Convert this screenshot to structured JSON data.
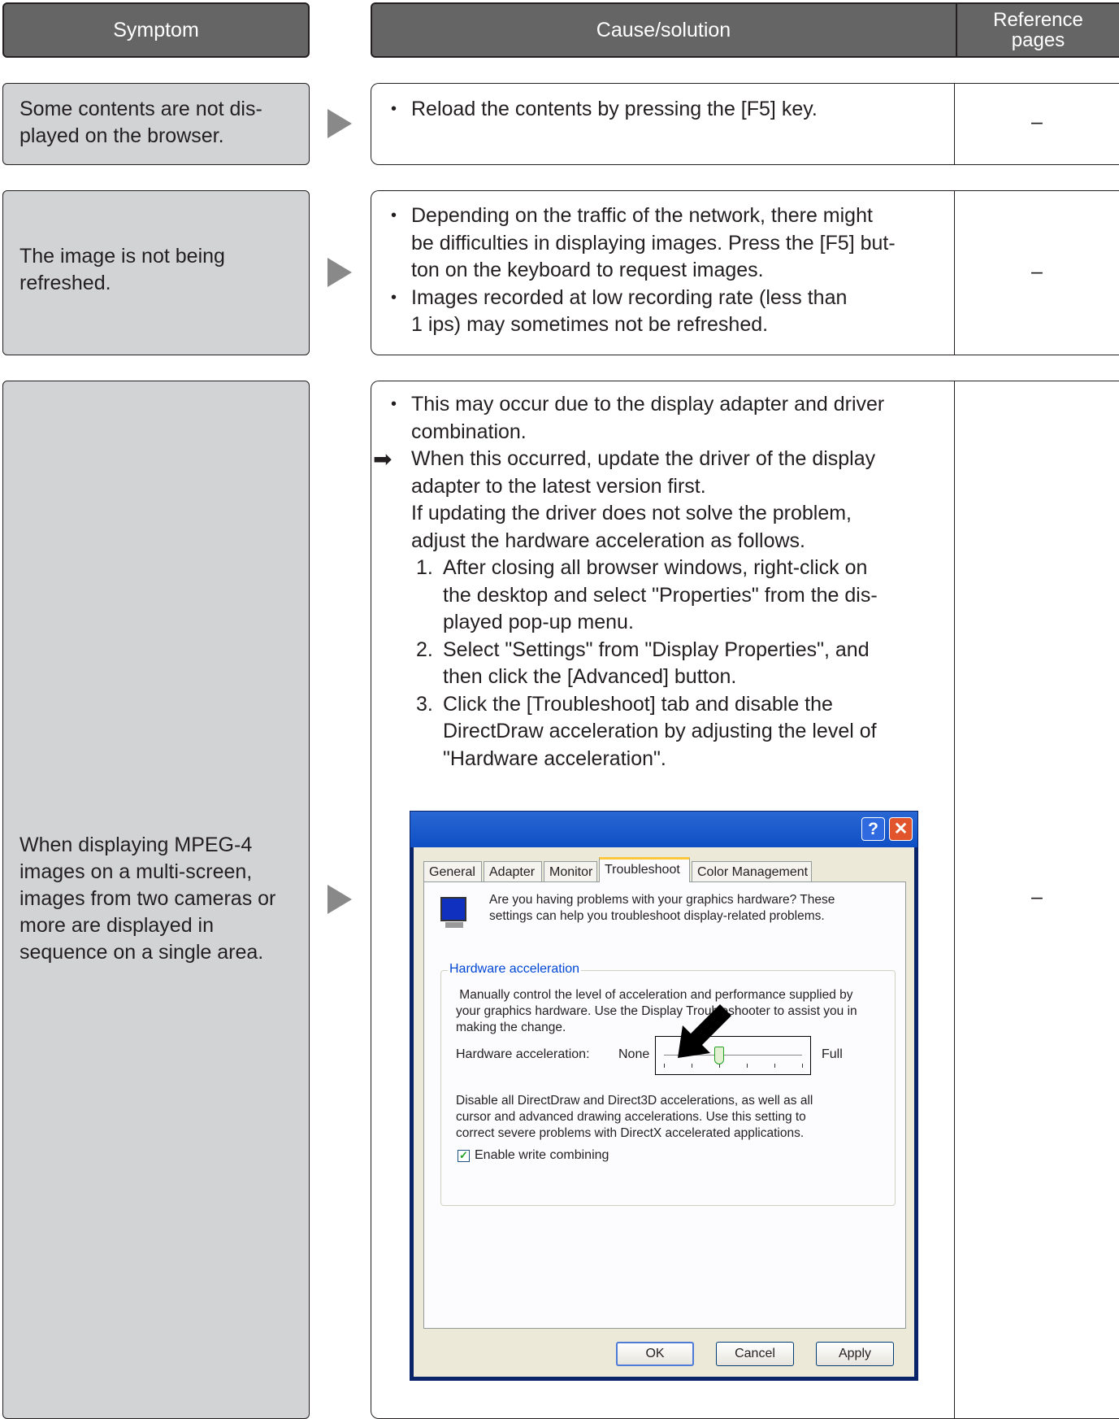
{
  "header": {
    "symptom": "Symptom",
    "cause": "Cause/solution",
    "reference_line1": "Reference",
    "reference_line2": "pages"
  },
  "rows": [
    {
      "symptom_lines": [
        "Some contents are not dis-",
        "played on the browser."
      ],
      "cause_bullets": [
        "Reload the contents by pressing the [F5] key."
      ],
      "reference": "–"
    },
    {
      "symptom_lines": [
        "The image is not being",
        "refreshed."
      ],
      "cause_bullets": [
        [
          "Depending on the traffic of the network, there might",
          "be difficulties in displaying images. Press the [F5] but-",
          "ton on the keyboard to request images."
        ],
        [
          "Images recorded at low recording rate (less than",
          "1 ips) may sometimes not be refreshed."
        ]
      ],
      "reference": "–"
    },
    {
      "symptom_lines": [
        "When displaying MPEG-4",
        "images on a multi-screen,",
        "images from two cameras or",
        "more are displayed in",
        "sequence on a single area."
      ],
      "cause_bullet": [
        "This may occur due to the display adapter and driver",
        "combination."
      ],
      "arrow_mark": "➡",
      "arrow_text": [
        "When this occurred, update the driver of the display",
        "adapter to the latest version first.",
        "If updating the driver does not solve the problem,",
        "adjust the hardware acceleration as follows."
      ],
      "steps": [
        {
          "n": "1.",
          "lines": [
            "After closing all browser windows, right-click on",
            "the desktop and select \"Properties\" from the dis-",
            "played pop-up menu."
          ]
        },
        {
          "n": "2.",
          "lines": [
            "Select \"Settings\" from \"Display Properties\", and",
            "then click the [Advanced] button."
          ]
        },
        {
          "n": "3.",
          "lines": [
            "Click the [Troubleshoot] tab and disable the",
            "DirectDraw acceleration by adjusting the level of",
            "\"Hardware acceleration\"."
          ]
        }
      ],
      "reference": "–"
    }
  ],
  "dialog": {
    "help_glyph": "?",
    "close_glyph": "✕",
    "tabs": [
      "General",
      "Adapter",
      "Monitor",
      "Troubleshoot",
      "Color Management"
    ],
    "active_tab": "Troubleshoot",
    "intro_lines": [
      "Are you having problems with your graphics hardware? These",
      "settings can help you troubleshoot display-related problems."
    ],
    "group_title": "Hardware acceleration",
    "group_desc_lines": [
      " Manually control the level of acceleration and performance supplied by",
      "your graphics hardware. Use the Display Troubleshooter to assist you in",
      "making the change."
    ],
    "hw_label": "Hardware acceleration:",
    "slider_min_label": "None",
    "slider_max_label": "Full",
    "slider_level": 0.4,
    "warn_lines": [
      "Disable all DirectDraw and Direct3D accelerations, as well as all",
      "cursor and advanced drawing accelerations. Use this setting to",
      "correct severe problems with DirectX accelerated applications."
    ],
    "checkbox_label": "Enable write combining",
    "checkbox_checked": true,
    "buttons": {
      "ok": "OK",
      "cancel": "Cancel",
      "apply": "Apply"
    }
  }
}
